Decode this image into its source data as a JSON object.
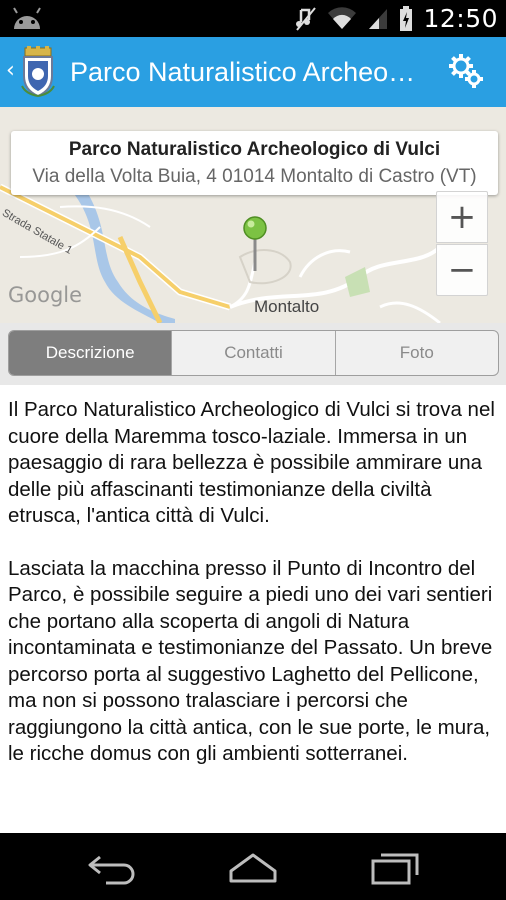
{
  "status_bar": {
    "time": "12:50",
    "icons": [
      "android-icon",
      "mute-icon",
      "wifi-icon",
      "signal-icon",
      "battery-icon"
    ]
  },
  "action_bar": {
    "back_glyph": "‹",
    "title": "Parco Naturalistico Archeologico di Vulci",
    "logo_icon": "municipal-crest-icon",
    "settings_icon": "settings-gears-icon",
    "color": "#2a9fe2"
  },
  "map": {
    "info_title": "Parco Naturalistico Archeologico di Vulci",
    "info_address": "Via della Volta Buia, 4 01014 Montalto di Castro (VT)",
    "zoom_in": "+",
    "zoom_out": "−",
    "google_logo": "Google",
    "place_label": "Montalto",
    "road_label": "Strada Statale 1",
    "pin_color": "#7cc243"
  },
  "tabs": {
    "items": [
      {
        "label": "Descrizione",
        "active": true
      },
      {
        "label": "Contatti",
        "active": false
      },
      {
        "label": "Foto",
        "active": false
      }
    ]
  },
  "content": {
    "paragraphs": [
      "Il Parco Naturalistico Archeologico di Vulci si trova nel cuore della Maremma tosco-laziale. Immersa in un paesaggio di rara bellezza è possibile ammirare una delle più affascinanti testimonianze della civiltà etrusca, l'antica città di Vulci.",
      "Lasciata la macchina presso il Punto di Incontro del Parco, è possibile seguire a piedi uno dei vari sentieri che portano alla scoperta di angoli di Natura incontaminata e testimonianze del Passato. Un breve percorso porta al suggestivo Laghetto del Pellicone, ma non si possono tralasciare i percorsi che raggiungono la città antica, con le sue porte, le mura, le ricche domus con gli ambienti sotterranei."
    ]
  },
  "nav_bar": {
    "icons": [
      "back-icon",
      "home-icon",
      "recent-apps-icon"
    ]
  }
}
